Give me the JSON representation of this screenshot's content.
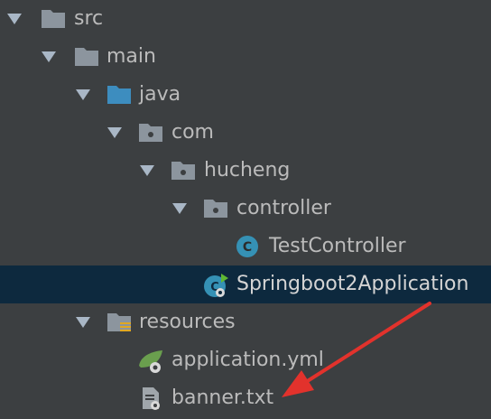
{
  "tree": {
    "nodes": [
      {
        "label": "src",
        "icon": "folder-icon"
      },
      {
        "label": "main",
        "icon": "folder-icon"
      },
      {
        "label": "java",
        "icon": "source-folder-icon"
      },
      {
        "label": "com",
        "icon": "package-icon"
      },
      {
        "label": "hucheng",
        "icon": "package-icon"
      },
      {
        "label": "controller",
        "icon": "package-icon"
      },
      {
        "label": "TestController",
        "icon": "java-class-icon"
      },
      {
        "label": "Springboot2Application",
        "icon": "spring-boot-class-icon"
      },
      {
        "label": "resources",
        "icon": "resources-folder-icon"
      },
      {
        "label": "application.yml",
        "icon": "spring-config-icon"
      },
      {
        "label": "banner.txt",
        "icon": "text-file-icon"
      }
    ]
  },
  "colors": {
    "background": "#3c3f41",
    "selection": "#0d293e",
    "text": "#bbbbbb",
    "folder": "#8c959e",
    "source_folder": "#3d8dbf",
    "class_icon": "#3591b5",
    "spring": "#6a9f4e",
    "arrow": "#e2322c"
  }
}
